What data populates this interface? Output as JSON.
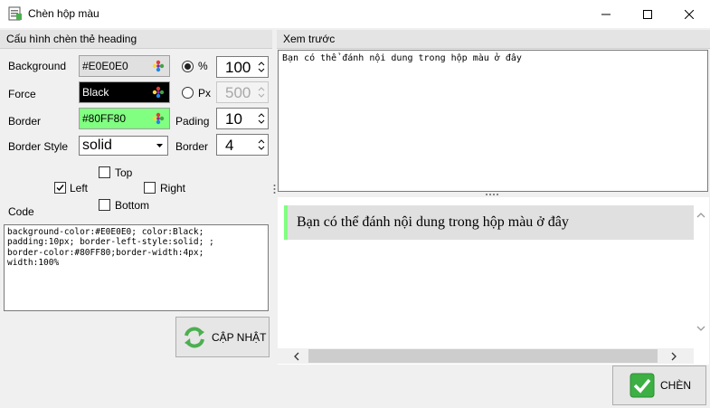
{
  "window": {
    "title": "Chèn hộp màu"
  },
  "left_panel": {
    "header": "Cấu hình chèn thẻ heading",
    "background": {
      "label": "Background",
      "value": "#E0E0E0",
      "color": "#E0E0E0"
    },
    "force": {
      "label": "Force",
      "value": "Black",
      "color": "#000000"
    },
    "border": {
      "label": "Border",
      "value": "#80FF80",
      "color": "#80FF80"
    },
    "border_style": {
      "label": "Border Style",
      "value": "solid"
    },
    "unit_percent": {
      "label": "%",
      "value": "100",
      "selected": true
    },
    "unit_px": {
      "label": "Px",
      "value": "500",
      "selected": false
    },
    "pading": {
      "label": "Pading",
      "value": "10"
    },
    "border_width": {
      "label": "Border",
      "value": "4"
    },
    "sides": {
      "top": "Top",
      "left": "Left",
      "right": "Right",
      "bottom": "Bottom",
      "left_checked": true
    },
    "code_label": "Code",
    "code": "background-color:#E0E0E0; color:Black;\npadding:10px; border-left-style:solid; ;\nborder-color:#80FF80;border-width:4px;\nwidth:100%",
    "update_button": "CẬP NHẬT"
  },
  "right_panel": {
    "header": "Xem trước",
    "source_text": "Bạn có thể đánh nội dung trong hộp màu ở đây",
    "rendered_text": "Bạn có thể đánh nội dung trong hộp màu ở đây"
  },
  "insert_button": "CHÈN",
  "colors": {
    "accent_green": "#80FF80",
    "check_green": "#3cb043"
  }
}
